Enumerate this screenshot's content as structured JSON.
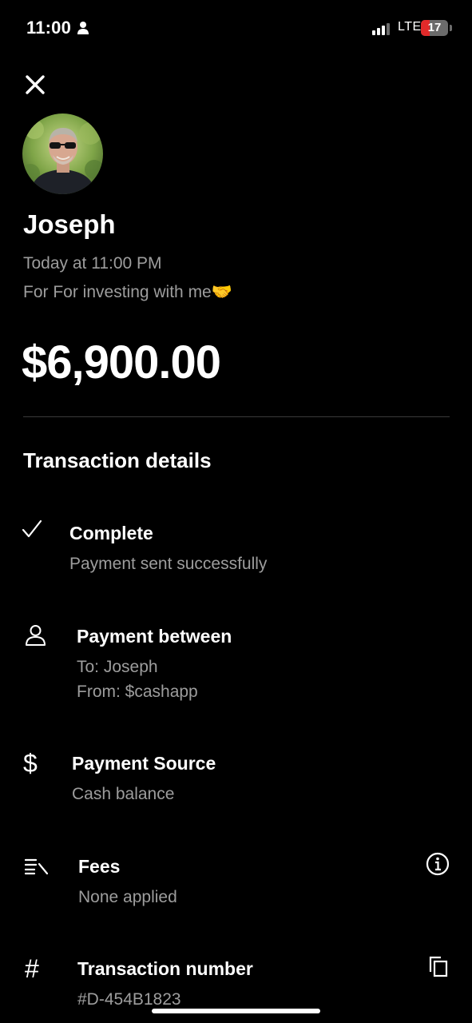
{
  "status_bar": {
    "time": "11:00",
    "network": "LTE",
    "battery": "17",
    "battery_color": "#e12a2a"
  },
  "header": {
    "name": "Joseph",
    "timestamp": "Today at 11:00 PM",
    "note": "For For investing with me🤝",
    "amount": "$6,900.00"
  },
  "details": {
    "title": "Transaction details",
    "status": {
      "icon": "check-icon",
      "title": "Complete",
      "subtitle": "Payment sent successfully"
    },
    "payment_between": {
      "icon": "person-icon",
      "title": "Payment between",
      "to": "To: Joseph",
      "from": "From: $cashapp"
    },
    "payment_source": {
      "icon": "dollar-icon",
      "title": "Payment Source",
      "subtitle": "Cash balance"
    },
    "fees": {
      "icon": "fees-icon",
      "title": "Fees",
      "subtitle": "None applied",
      "action_icon": "info-icon"
    },
    "transaction_number": {
      "icon": "hash-icon",
      "title": "Transaction number",
      "value": "#D-454B1823",
      "action_icon": "copy-icon"
    }
  }
}
